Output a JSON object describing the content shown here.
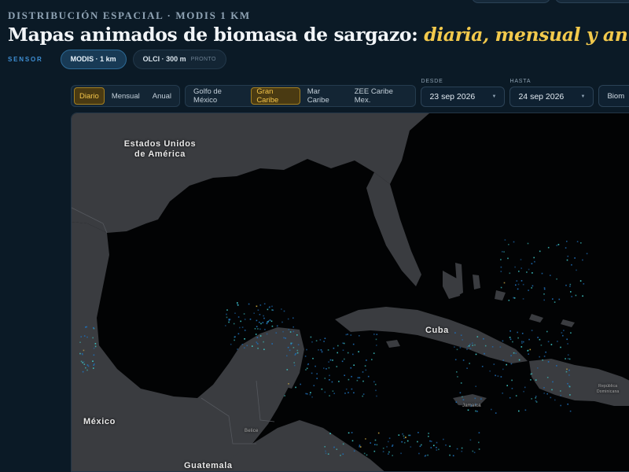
{
  "header": {
    "kicker": "DISTRIBUCIÓN ESPACIAL · MODIS 1 KM",
    "title_main": "Mapas animados de biomasa de sargazo: ",
    "title_accent": "diaria, mensual y anual"
  },
  "sensor": {
    "label": "SENSOR",
    "options": [
      {
        "label": "MODIS · 1 km",
        "active": true
      },
      {
        "label": "OLCI · 300 m",
        "badge": "PRONTO",
        "active": false
      }
    ]
  },
  "period_tabs": [
    {
      "label": "Diario",
      "active": true
    },
    {
      "label": "Mensual",
      "active": false
    },
    {
      "label": "Anual",
      "active": false
    }
  ],
  "region_tabs": [
    {
      "label": "Golfo de México",
      "active": false
    },
    {
      "label": "Gran Caribe",
      "active": true
    },
    {
      "label": "Mar Caribe",
      "active": false
    },
    {
      "label": "ZEE Caribe Mex.",
      "active": false
    }
  ],
  "date_from": {
    "label": "DESDE",
    "value": "23 sep 2026"
  },
  "date_to": {
    "label": "HASTA",
    "value": "24 sep 2026"
  },
  "extra_select": {
    "value": "Biom"
  },
  "map": {
    "labels": {
      "usa": "Estados Unidos\nde América",
      "mexico": "México",
      "cuba": "Cuba",
      "guatemala": "Guatemala",
      "belice": "Belice",
      "jamaica": "Jamaica",
      "republica": "República\nDominicana"
    },
    "colors": {
      "ocean": "#020304",
      "land": "#3a3c40",
      "border": "#55585e",
      "sargassum_low": "#1f6fb8",
      "sargassum_mid": "#3fc7c7",
      "sargassum_high": "#f2c94c"
    }
  }
}
